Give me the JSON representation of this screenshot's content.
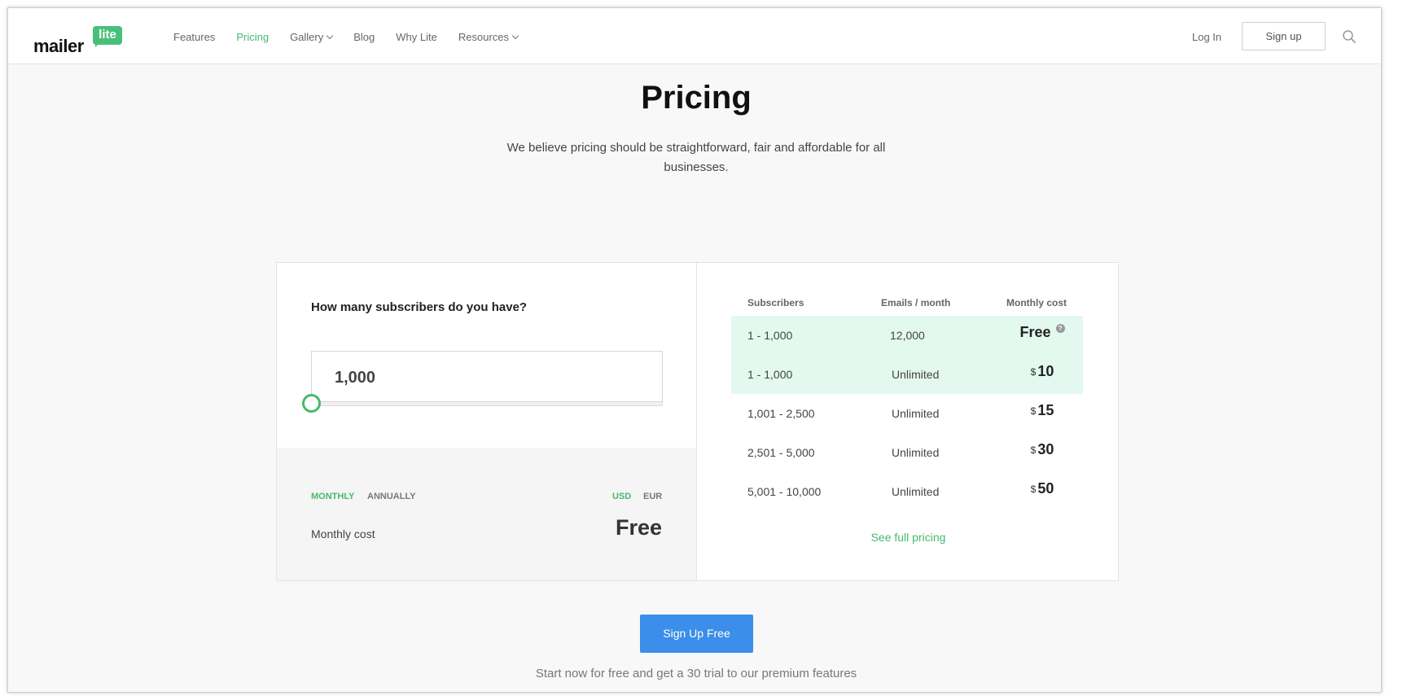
{
  "header": {
    "logo": {
      "word": "mailer",
      "bubble": "lite"
    },
    "nav": [
      {
        "label": "Features",
        "active": false,
        "dropdown": false
      },
      {
        "label": "Pricing",
        "active": true,
        "dropdown": false
      },
      {
        "label": "Gallery",
        "active": false,
        "dropdown": true
      },
      {
        "label": "Blog",
        "active": false,
        "dropdown": false
      },
      {
        "label": "Why Lite",
        "active": false,
        "dropdown": false
      },
      {
        "label": "Resources",
        "active": false,
        "dropdown": true
      }
    ],
    "login": "Log In",
    "signup": "Sign up",
    "search_icon": "search-icon"
  },
  "hero": {
    "title": "Pricing",
    "subtitle": "We believe pricing should be straightforward, fair and affordable for all businesses."
  },
  "calculator": {
    "question": "How many subscribers do you have?",
    "subscribers_value": "1,000",
    "slider_level": 0,
    "billing": {
      "monthly": "MONTHLY",
      "annually": "ANNUALLY",
      "selected": "monthly"
    },
    "currency": {
      "usd": "USD",
      "eur": "EUR",
      "selected": "usd"
    },
    "cost_label": "Monthly cost",
    "cost_value": "Free"
  },
  "pricing_table": {
    "headers": [
      "Subscribers",
      "Emails / month",
      "Monthly cost"
    ],
    "rows": [
      {
        "subscribers": "1 - 1,000",
        "emails": "12,000",
        "currency": "",
        "cost": "Free",
        "highlight": true,
        "info": true
      },
      {
        "subscribers": "1 - 1,000",
        "emails": "Unlimited",
        "currency": "$",
        "cost": "10",
        "highlight": true,
        "info": false
      },
      {
        "subscribers": "1,001 - 2,500",
        "emails": "Unlimited",
        "currency": "$",
        "cost": "15",
        "highlight": false,
        "info": false
      },
      {
        "subscribers": "2,501 - 5,000",
        "emails": "Unlimited",
        "currency": "$",
        "cost": "30",
        "highlight": false,
        "info": false
      },
      {
        "subscribers": "5,001 - 10,000",
        "emails": "Unlimited",
        "currency": "$",
        "cost": "50",
        "highlight": false,
        "info": false
      }
    ],
    "info_mark": "?",
    "see_full": "See full pricing"
  },
  "cta": {
    "button": "Sign Up Free",
    "note": "Start now for free and get a 30 trial to our premium features"
  },
  "colors": {
    "accent_green": "#46b96f",
    "highlight_row": "#e3f8ee",
    "cta_blue": "#3b8eea"
  }
}
